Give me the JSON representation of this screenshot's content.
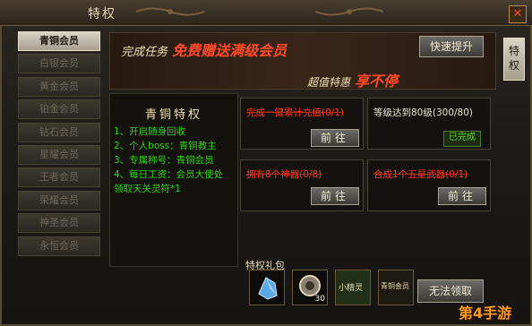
{
  "window": {
    "title": "特权",
    "close_symbol": "✕"
  },
  "sidebar": {
    "items": [
      {
        "label": "青铜会员",
        "active": true
      },
      {
        "label": "白银会员",
        "active": false
      },
      {
        "label": "黄金会员",
        "active": false
      },
      {
        "label": "铂金会员",
        "active": false
      },
      {
        "label": "钻石会员",
        "active": false
      },
      {
        "label": "星耀会员",
        "active": false
      },
      {
        "label": "王者会员",
        "active": false
      },
      {
        "label": "荣耀会员",
        "active": false
      },
      {
        "label": "神圣会员",
        "active": false
      },
      {
        "label": "永恒会员",
        "active": false
      }
    ]
  },
  "right_tab": {
    "label": "特权"
  },
  "banner": {
    "line1_prefix": "完成任务",
    "line1_highlight": "免费赠送满级会员",
    "line2_prefix": "超值特惠",
    "line2_highlight": "享不停",
    "quick_button": "快速提升"
  },
  "privilege": {
    "title": "青铜特权",
    "lines": [
      "1、开启随身回收",
      "2、个人boss：青铜教主",
      "3、专属称号：青铜会员",
      "4、每日工资：会员大使处",
      "领取天关灵符*1"
    ]
  },
  "tasks": [
    {
      "text": "完成一键累计充值(0/1)",
      "style": "red",
      "button": "前往",
      "done": false
    },
    {
      "text": "等级达到80级(300/80)",
      "style": "white",
      "button": "",
      "done": true,
      "done_label": "已完成"
    },
    {
      "text": "拥有8个神器(0/8)",
      "style": "red",
      "button": "前往",
      "done": false
    },
    {
      "text": "合成1个五星武器(0/1)",
      "style": "red",
      "button": "前往",
      "done": false
    }
  ],
  "gifts": {
    "label": "特权礼包",
    "items": [
      {
        "icon": "crystal-icon",
        "count": ""
      },
      {
        "icon": "compass-icon",
        "count": "30"
      },
      {
        "icon": "sprite-card-icon",
        "count": "",
        "text": "小精灵"
      },
      {
        "icon": "title-card-icon",
        "count": "",
        "text": "青铜会员"
      }
    ],
    "claim_button": "无法领取"
  },
  "watermark": "第4手游",
  "colors": {
    "accent_red": "#ff3a20",
    "accent_green": "#33d21a",
    "gold": "#e7d9b5"
  }
}
